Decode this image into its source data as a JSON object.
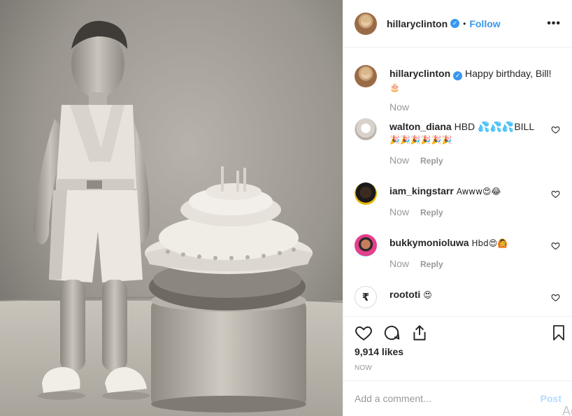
{
  "header": {
    "username": "hillaryclinton",
    "verified_glyph": "✓",
    "separator": "•",
    "follow_label": "Follow",
    "more_label": "•••"
  },
  "caption": {
    "username": "hillaryclinton",
    "verified_glyph": "✓",
    "text": "Happy birthday, Bill!",
    "emoji": "🎂",
    "time": "Now"
  },
  "comments": [
    {
      "username": "walton_diana",
      "text": "HBD 💦💦💦BILL",
      "text2": "🎉🎉🎉🎉🎉🎉",
      "time": "Now",
      "reply": "Reply"
    },
    {
      "username": "iam_kingstarr",
      "text": "Awww😍😂",
      "time": "Now",
      "reply": "Reply"
    },
    {
      "username": "bukkymonioluwa",
      "text": "Hbd😍🙆",
      "time": "Now",
      "reply": "Reply"
    },
    {
      "username": "roototi",
      "text": "😍",
      "avatar_letter": "₹"
    }
  ],
  "footer": {
    "likes": "9,914 likes",
    "timestamp": "NOW",
    "comment_placeholder": "Add a comment...",
    "post_label": "Post",
    "ghost_text": "Ac"
  },
  "colors": {
    "link_blue": "#3897f0",
    "post_disabled": "#b3dbff",
    "muted": "#999999",
    "border": "#efefef"
  },
  "icons": [
    "heart-icon",
    "comment-icon",
    "share-icon",
    "bookmark-icon",
    "verified-badge-icon",
    "more-options-icon"
  ]
}
